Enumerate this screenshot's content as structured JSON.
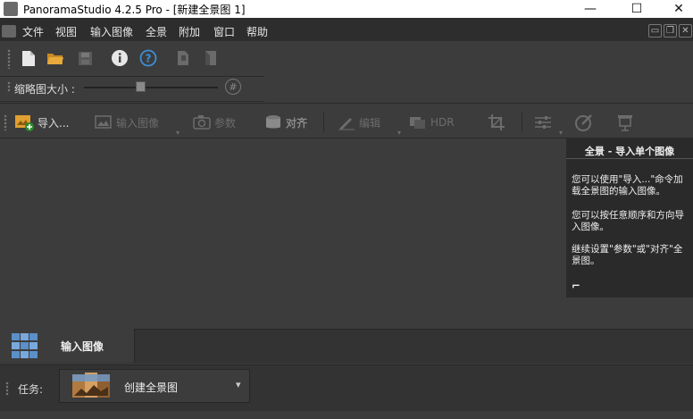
{
  "window": {
    "title": "PanoramaStudio 4.2.5 Pro - [新建全景图 1]",
    "controls": [
      "—",
      "☐",
      "✕"
    ]
  },
  "menu": {
    "items": [
      "文件",
      "视图",
      "输入图像",
      "全景",
      "附加",
      "窗口",
      "帮助"
    ]
  },
  "thumbnail": {
    "label": "缩略图大小 :",
    "level": 0.42
  },
  "toolbar": {
    "import": "导入...",
    "input_images": "输入图像",
    "params": "参数",
    "align": "对齐",
    "edit": "编辑",
    "hdr": "HDR"
  },
  "help": {
    "title": "全景 - 导入单个图像",
    "p1": "您可以使用\"导入...\"命令加载全景图的输入图像。",
    "p2": "您可以按任意顺序和方向导入图像。",
    "p3": "继续设置\"参数\"或\"对齐\"全景图。",
    "corner": "⌐"
  },
  "tabs": {
    "import_images": "输入图像"
  },
  "task": {
    "label": "任务:",
    "value": "创建全景图",
    "arrow": "▾"
  },
  "colors": {
    "background": "#3c3c3c",
    "menubar": "#2d2d2d",
    "accent_blue": "#3c8fd8",
    "folder_orange": "#e0a030",
    "help_bg": "#2a2a2a"
  }
}
